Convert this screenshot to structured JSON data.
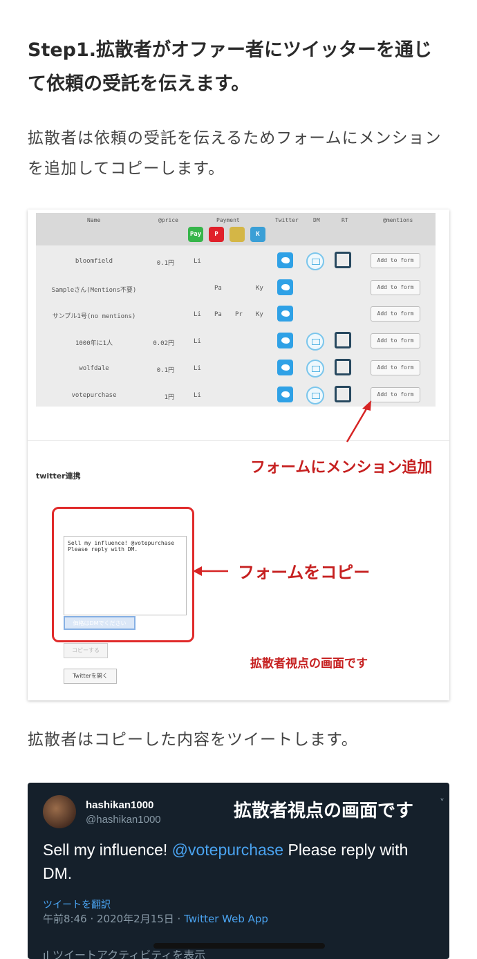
{
  "heading": "Step1.拡散者がオファー者にツイッターを通じて依頼の受託を伝えます。",
  "para1": "拡散者は依頼の受託を伝えるためフォームにメンションを追加してコピーします。",
  "para2": "拡散者はコピーした内容をツイートします。",
  "table": {
    "headers": {
      "name": "Name",
      "price": "@price",
      "payment": "Payment",
      "twitter": "Twitter",
      "dm": "DM",
      "rt": "RT",
      "mentions": "@mentions"
    },
    "payment_icons": [
      {
        "name": "line-pay-icon",
        "label": "Pay",
        "color": "#36b54a"
      },
      {
        "name": "paypay-icon",
        "label": "P",
        "color": "#e0202a"
      },
      {
        "name": "emoji-pay-icon",
        "label": "",
        "color": "#d4b646"
      },
      {
        "name": "kyash-icon",
        "label": "K",
        "color": "#3a9fd6"
      }
    ],
    "rows": [
      {
        "name": "bloomfield",
        "price": "0.1円",
        "pay": [
          "Li",
          "",
          "",
          ""
        ],
        "dm": true,
        "rt": true,
        "button": "Add to form"
      },
      {
        "name": "Sampleさん(Mentions不要)",
        "price": "",
        "pay": [
          "",
          "Pa",
          "",
          "Ky"
        ],
        "dm": false,
        "rt": false,
        "button": "Add to form"
      },
      {
        "name": "サンプル1号(no mentions)",
        "price": "",
        "pay": [
          "Li",
          "Pa",
          "Pr",
          "Ky"
        ],
        "dm": false,
        "rt": false,
        "button": "Add to form"
      },
      {
        "name": "1000年に1人",
        "price": "0.02円",
        "pay": [
          "Li",
          "",
          "",
          ""
        ],
        "dm": true,
        "rt": true,
        "button": "Add to form"
      },
      {
        "name": "wolfdale",
        "price": "0.1円",
        "pay": [
          "Li",
          "",
          "",
          ""
        ],
        "dm": true,
        "rt": true,
        "button": "Add to form"
      },
      {
        "name": "votepurchase",
        "price": "1円",
        "pay": [
          "Li",
          "",
          "",
          ""
        ],
        "dm": true,
        "rt": true,
        "button": "Add to form"
      }
    ]
  },
  "twitter_label": "twitter連携",
  "form": {
    "textarea": "Sell my influence! @votepurchase\nPlease reply with DM.",
    "dm_field": "価格はDMでください",
    "copy_button": "コピーする",
    "open_button": "Twitterを開く"
  },
  "annotations": {
    "add_mention": "フォームにメンション追加",
    "copy_form": "フォームをコピー",
    "viewpoint": "拡散者視点の画面です",
    "arrow_color": "#d62424"
  },
  "tweet": {
    "display_name": "hashikan1000",
    "handle": "@hashikan1000",
    "viewpoint": "拡散者視点の画面です",
    "text_before": "Sell my influence! ",
    "mention": "@votepurchase",
    "text_after": " Please reply with DM.",
    "translate": "ツイートを翻訳",
    "time": "午前8:46 · 2020年2月15日 · ",
    "app": "Twitter Web App",
    "activity": "ツイートアクティビティを表示"
  }
}
